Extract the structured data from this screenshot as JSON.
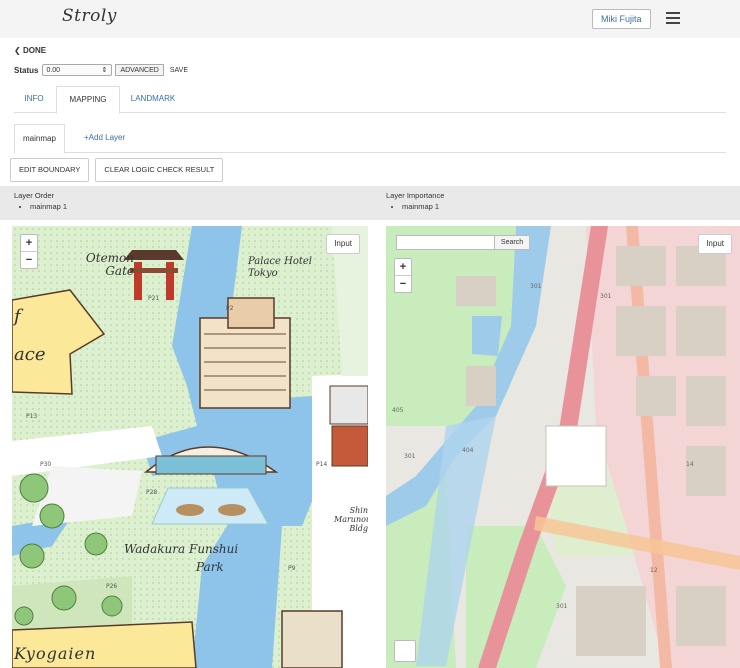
{
  "header": {
    "logo": "Stroly",
    "user": "Miki Fujita"
  },
  "done_label": "DONE",
  "status": {
    "label": "Status",
    "value": "0.00",
    "advanced": "ADVANCED",
    "save": "SAVE"
  },
  "tabs": [
    {
      "label": "INFO"
    },
    {
      "label": "MAPPING"
    },
    {
      "label": "LANDMARK"
    }
  ],
  "subtabs": [
    {
      "label": "mainmap"
    },
    {
      "label": "Add Layer"
    }
  ],
  "actions": {
    "edit_boundary": "EDIT BOUNDARY",
    "clear_logic": "CLEAR LOGIC CHECK RESULT"
  },
  "layer_order": {
    "title": "Layer Order",
    "items": [
      "mainmap 1"
    ]
  },
  "layer_importance": {
    "title": "Layer Importance",
    "items": [
      "mainmap 1"
    ]
  },
  "left_map": {
    "input_label": "Input",
    "labels": {
      "gate": "Otemon Gate",
      "hotel": "Palace Hotel Tokyo",
      "park1": "Wadakura Funshui",
      "park2": "Park",
      "kyogaien": "Kyogaien",
      "ace": "ace",
      "shin": "Shin Marunouchi Bldg",
      "f": "f"
    }
  },
  "right_map": {
    "input_label": "Input",
    "search_label": "Search"
  },
  "colors": {
    "link": "#3a6fa8",
    "water": "#8ec3ea",
    "park": "#dff0d2",
    "osm_road": "#e8929a",
    "osm_park": "#c8ecbb"
  }
}
